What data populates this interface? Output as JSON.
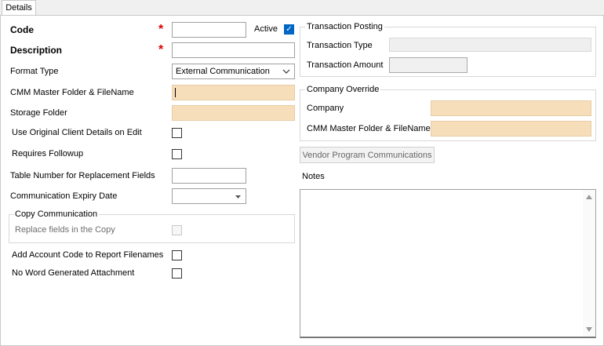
{
  "tabs": [
    {
      "label": "Details"
    }
  ],
  "left": {
    "code_label": "Code",
    "description_label": "Description",
    "active_label": "Active",
    "format_type_label": "Format Type",
    "format_type_value": "External Communication",
    "cmm_master_label": "CMM Master Folder & FileName",
    "storage_folder_label": "Storage Folder",
    "use_original_label": "Use Original Client Details on Edit",
    "requires_followup_label": "Requires Followup",
    "table_number_label": "Table Number for Replacement Fields",
    "expiry_label": "Communication Expiry Date",
    "copy_group_title": "Copy Communication",
    "replace_fields_label": "Replace fields in the Copy",
    "add_account_label": "Add Account Code to Report Filenames",
    "no_word_label": "No Word Generated Attachment"
  },
  "right": {
    "transaction_group_title": "Transaction Posting",
    "transaction_type_label": "Transaction Type",
    "transaction_amount_label": "Transaction Amount",
    "company_group_title": "Company Override",
    "company_label": "Company",
    "cmm_override_label": "CMM Master Folder & FileName",
    "vendor_button_label": "Vendor Program Communications",
    "notes_label": "Notes"
  },
  "icons": {
    "dropdown": "chevron-down",
    "scroll_up": "triangle-up",
    "scroll_down": "triangle-down",
    "checkmark": "check"
  }
}
